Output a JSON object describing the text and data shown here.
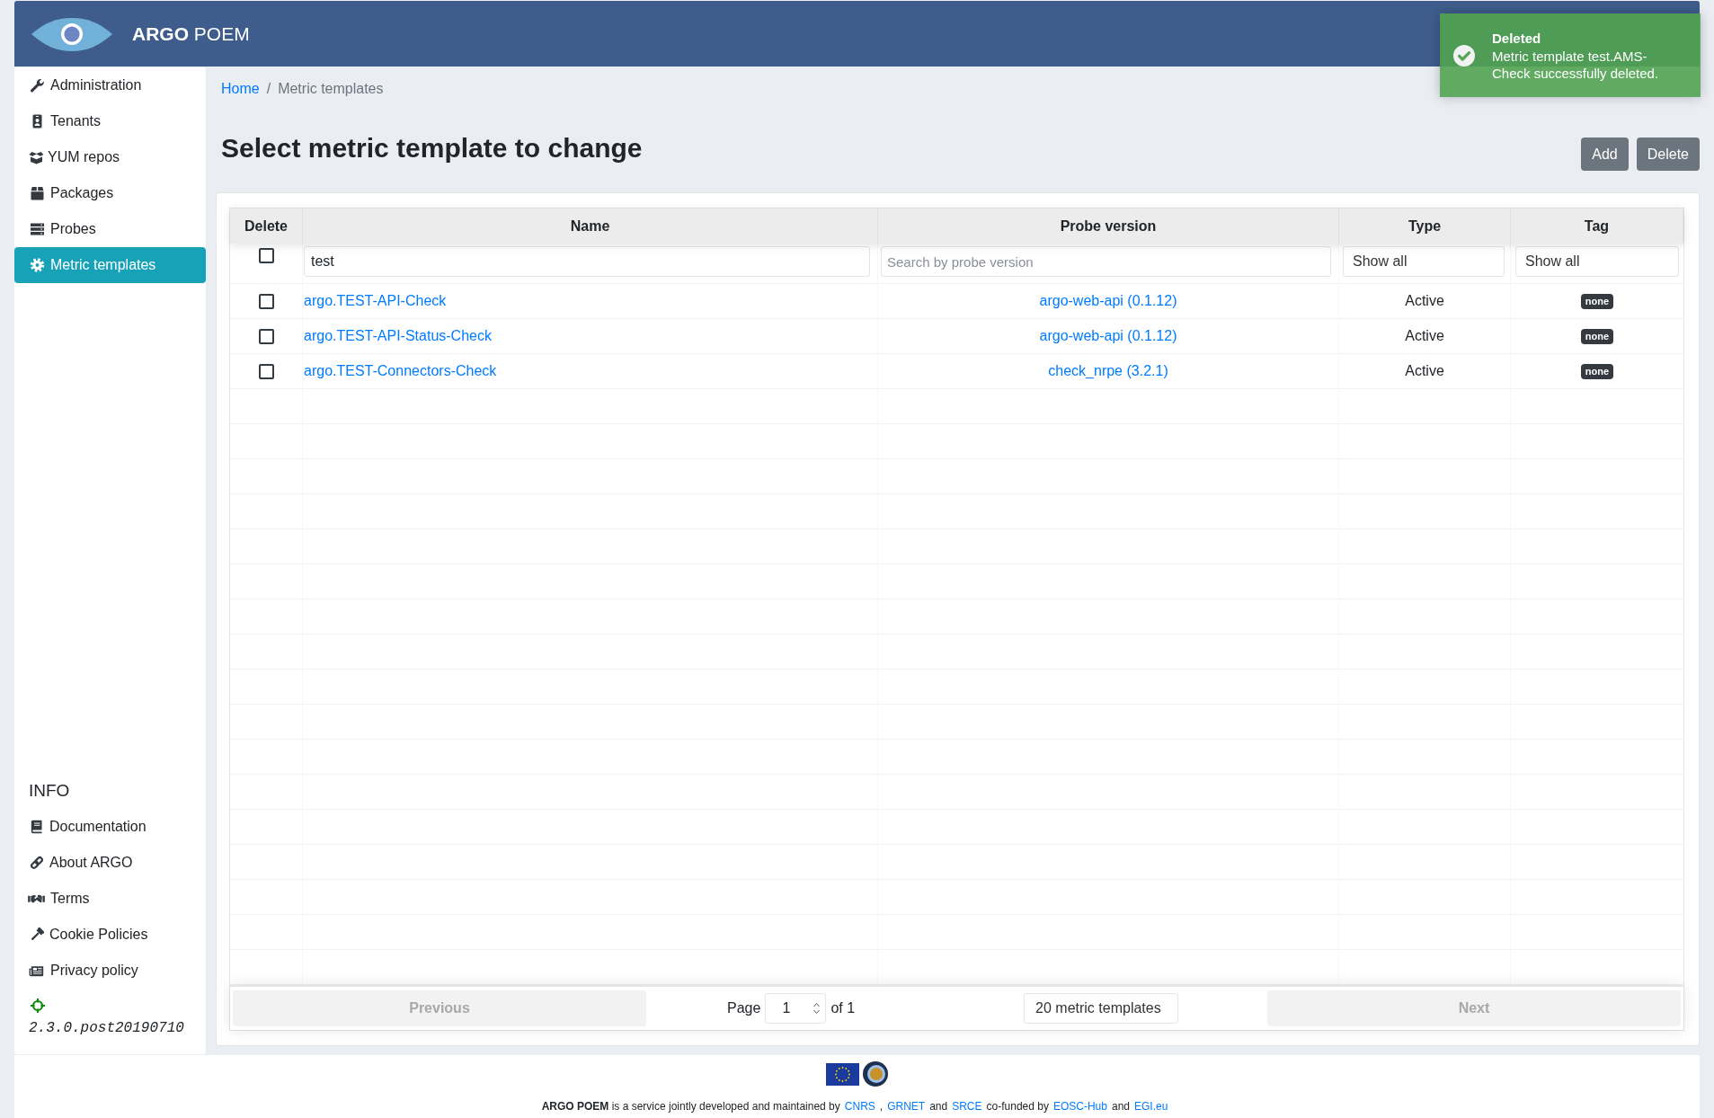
{
  "header": {
    "brand": "**ARGO** POEM"
  },
  "toast": {
    "title": "Deleted",
    "message": "Metric template test.AMS-Check successfully deleted."
  },
  "sidebar": {
    "items": [
      {
        "label": "Administration",
        "selected": false
      },
      {
        "label": "Tenants",
        "selected": false
      },
      {
        "label": "YUM repos",
        "selected": false
      },
      {
        "label": "Packages",
        "selected": false
      },
      {
        "label": "Probes",
        "selected": false
      },
      {
        "label": "Metric templates",
        "selected": true
      }
    ],
    "info_heading": "INFO",
    "info_items": [
      {
        "label": "Documentation"
      },
      {
        "label": "About ARGO"
      },
      {
        "label": "Terms"
      },
      {
        "label": "Cookie Policies"
      },
      {
        "label": "Privacy policy"
      }
    ],
    "version": "2.3.0.post20190710"
  },
  "breadcrumb": {
    "items": [
      {
        "label": "Home",
        "kind": "link"
      },
      {
        "label": "Metric templates",
        "kind": "current"
      }
    ],
    "separator": "/"
  },
  "page_title": "Select metric template to change",
  "actions": [
    {
      "label": "Add"
    },
    {
      "label": "Delete"
    }
  ],
  "table": {
    "columns": [
      "Delete",
      "Name",
      "Probe version",
      "Type",
      "Tag"
    ],
    "filters": {
      "select_all": {
        "checked": false
      },
      "name": {
        "value": "test"
      },
      "probe_version": {
        "placeholder": "Search by probe version"
      },
      "type": {
        "value": "Show all"
      },
      "tag": {
        "value": "Show all"
      }
    },
    "rows": [
      {
        "checked": false,
        "name": "argo.TEST-API-Check",
        "probe_version": "argo-web-api (0.1.12)",
        "type": "Active",
        "tag": "none"
      },
      {
        "checked": false,
        "name": "argo.TEST-API-Status-Check",
        "probe_version": "argo-web-api (0.1.12)",
        "type": "Active",
        "tag": "none"
      },
      {
        "checked": false,
        "name": "argo.TEST-Connectors-Check",
        "probe_version": "check_nrpe (3.2.1)",
        "type": "Active",
        "tag": "none"
      }
    ]
  },
  "pagination": {
    "previous": {
      "label": "Previous",
      "disabled": true
    },
    "page_label": "Page",
    "page": "1",
    "of": "of 1",
    "page_size": "20 metric templates",
    "next": {
      "label": "Next",
      "disabled": true
    }
  },
  "footer": {
    "parts": [
      {
        "kind": "text",
        "text": "**ARGO POEM** is a service jointly developed and maintained by"
      },
      {
        "kind": "link",
        "text": "CNRS"
      },
      {
        "kind": "text",
        "text": ","
      },
      {
        "kind": "link",
        "text": "GRNET"
      },
      {
        "kind": "text",
        "text": "and"
      },
      {
        "kind": "link",
        "text": "SRCE"
      },
      {
        "kind": "text",
        "text": "co-funded by"
      },
      {
        "kind": "link",
        "text": "EOSC-Hub"
      },
      {
        "kind": "text",
        "text": "and"
      },
      {
        "kind": "link",
        "text": "EGI.eu"
      }
    ]
  }
}
